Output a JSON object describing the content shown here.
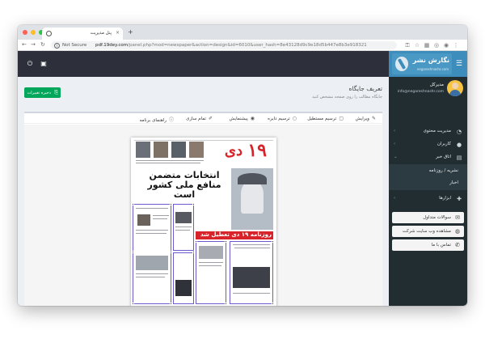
{
  "browser": {
    "tab_title": "پنل مدیریت",
    "security_label": "Not Secure",
    "url_host": "pdf.19dey.com",
    "url_path": "/panel.php?mod=newspaper&action=design&id=6010&user_hash=8e43128d9c9e18d5b447e8b3e918321",
    "new_tab": "+",
    "tab_close": "×"
  },
  "app": {
    "title": "نگارش نشر",
    "subtitle": "negareshnashr.com"
  },
  "user": {
    "name": "مدیرکل",
    "email": "info@negareshnashr.com"
  },
  "sidebar": {
    "items": [
      {
        "label": "مدیریت محتوی",
        "icon": "dashboard-icon"
      },
      {
        "label": "کاربران",
        "icon": "user-icon"
      },
      {
        "label": "اتاق خبر",
        "icon": "newspaper-icon"
      },
      {
        "label": "ابزارها",
        "icon": "puzzle-icon"
      }
    ],
    "submenu": [
      {
        "label": "نشریه / روزنامه"
      },
      {
        "label": "اخبار"
      }
    ],
    "widgets": [
      {
        "label": "سوالات متداول",
        "icon": "comments-icon"
      },
      {
        "label": "مشاهده وب سایت شرکت",
        "icon": "globe-icon"
      },
      {
        "label": "تماس با ما",
        "icon": "phone-icon"
      }
    ]
  },
  "page": {
    "title": "تعریف جایگاه",
    "subtitle": "جایگاه مطالب را روی صفحه مشخص کنید",
    "save_label": "ذخیره تغییرات"
  },
  "tools": [
    {
      "label": "ویرایش",
      "icon": "edit-icon"
    },
    {
      "label": "ترسیم مستطیل",
      "icon": "rectangle-icon"
    },
    {
      "label": "ترسیم دایره",
      "icon": "circle-icon"
    },
    {
      "label": "پیشنمایش",
      "icon": "eye-icon"
    },
    {
      "label": "تمام سازی",
      "icon": "brush-icon"
    },
    {
      "label": "راهنمای برنامه",
      "icon": "info-icon"
    }
  ],
  "newspaper": {
    "masthead_num": "۱۹",
    "masthead_word": "دی",
    "headline_1": "انتخابات متضمن",
    "headline_2": "منافع ملی کشور است",
    "strip_text": "روزنامه ۱۹ دی تعطیل شد"
  },
  "colors": {
    "topbar": "#2d2f3a",
    "sidebar": "#222d32",
    "logo": "#3c8dbc",
    "save": "#00a65a",
    "masthead": "#d8232a",
    "region_outline": "#6a5acd"
  }
}
